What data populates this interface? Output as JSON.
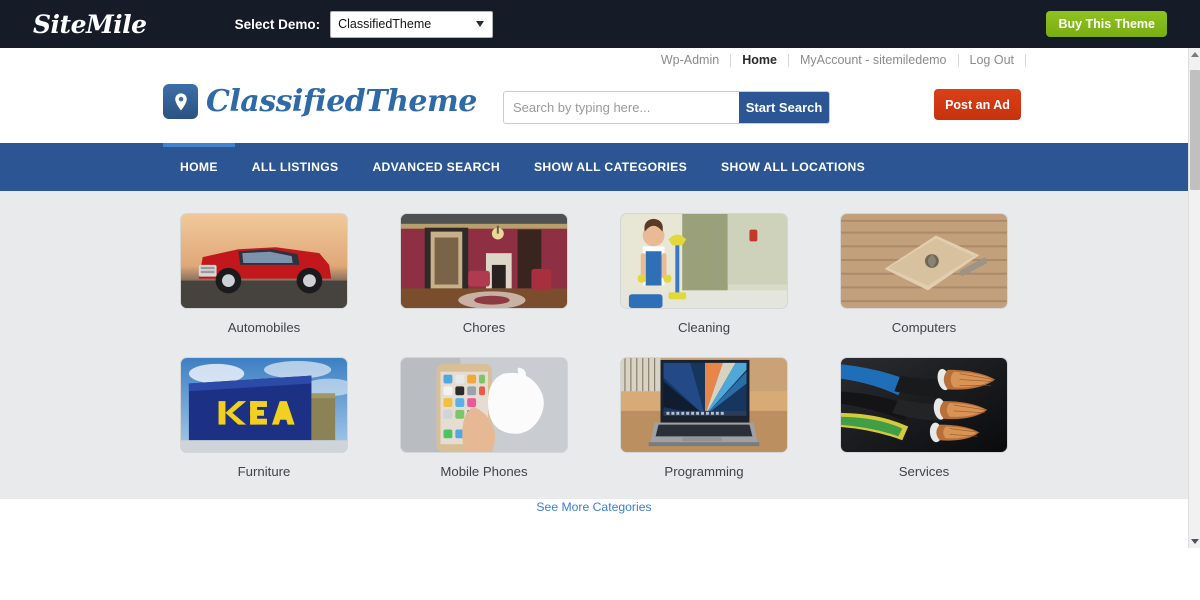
{
  "demo_bar": {
    "brand": "SiteMile",
    "select_label": "Select Demo:",
    "selected_demo": "ClassifiedTheme",
    "demo_options": [
      "ClassifiedTheme"
    ],
    "buy_button": "Buy This Theme",
    "buy_button_color": "#8ec320",
    "background_color": "#161b28"
  },
  "utility_nav": {
    "items": [
      {
        "label": "Wp-Admin",
        "active": false
      },
      {
        "label": "Home",
        "active": true
      },
      {
        "label": "MyAccount - sitemiledemo",
        "active": false
      },
      {
        "label": "Log Out",
        "active": false
      }
    ]
  },
  "masthead": {
    "logo_icon": "map-pin-icon",
    "logo_text": "ClassifiedTheme",
    "logo_color": "#2e6aa8",
    "search": {
      "placeholder": "Search by typing here...",
      "value": "",
      "button_label": "Start Search",
      "button_color": "#2b5693"
    },
    "post_ad_button": "Post an Ad",
    "post_ad_color": "#c6320d"
  },
  "main_nav": {
    "background_color": "#2b5693",
    "active_indicator_color": "#4083cf",
    "items": [
      {
        "label": "HOME",
        "active": true
      },
      {
        "label": "ALL LISTINGS",
        "active": false
      },
      {
        "label": "ADVANCED SEARCH",
        "active": false
      },
      {
        "label": "SHOW ALL CATEGORIES",
        "active": false
      },
      {
        "label": "SHOW ALL LOCATIONS",
        "active": false
      }
    ]
  },
  "content": {
    "background_color": "#e8eaec",
    "categories": [
      {
        "label": "Automobiles",
        "image": "red-pickup-truck-photo"
      },
      {
        "label": "Chores",
        "image": "victorian-living-room-photo"
      },
      {
        "label": "Cleaning",
        "image": "cleaner-with-mop-photo"
      },
      {
        "label": "Computers",
        "image": "gold-laptop-on-desk-photo"
      },
      {
        "label": "Furniture",
        "image": "ikea-store-building-photo"
      },
      {
        "label": "Mobile Phones",
        "image": "hand-holding-smartphone-photo"
      },
      {
        "label": "Programming",
        "image": "laptop-on-wooden-desk-photo"
      },
      {
        "label": "Services",
        "image": "copper-electrical-cables-photo"
      }
    ],
    "see_more_label": "See More Categories",
    "see_more_color": "#3d7ed1"
  },
  "scrollbar": {
    "up_arrow": "scroll-up-arrow-icon",
    "down_arrow": "scroll-down-arrow-icon"
  }
}
